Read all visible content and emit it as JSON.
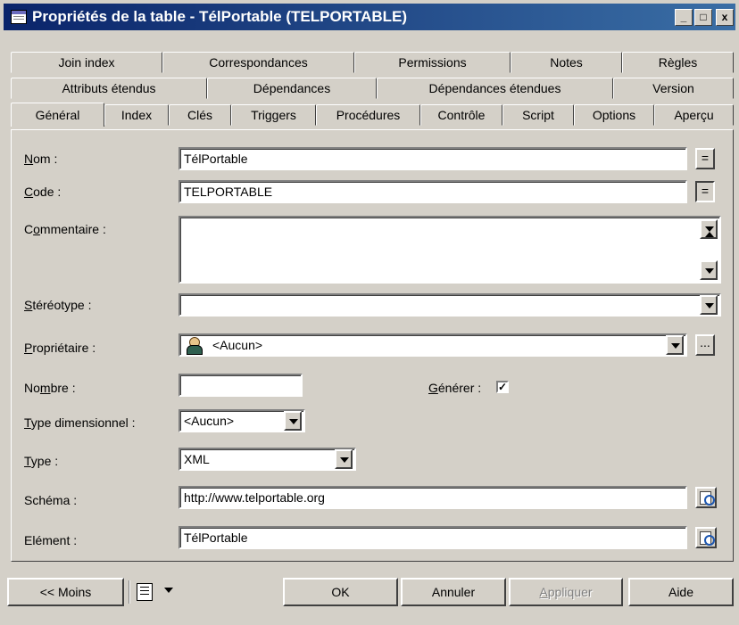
{
  "window": {
    "title": "Propriétés de la table - TélPortable (TELPORTABLE)",
    "controls": {
      "minimize": "_",
      "maximize": "□",
      "close": "x"
    }
  },
  "tabs": {
    "row1": [
      "Join index",
      "Correspondances",
      "Permissions",
      "Notes",
      "Règles"
    ],
    "row2": [
      "Attributs étendus",
      "Dépendances",
      "Dépendances étendues",
      "Version"
    ],
    "row3": [
      "Général",
      "Index",
      "Clés",
      "Triggers",
      "Procédures",
      "Contrôle",
      "Script",
      "Options",
      "Aperçu"
    ],
    "active": "Général"
  },
  "form": {
    "nom": {
      "label_ul": "N",
      "label_rest": "om :",
      "value": "TélPortable",
      "button": "="
    },
    "code": {
      "label_ul": "C",
      "label_rest": "ode :",
      "value": "TELPORTABLE",
      "button": "="
    },
    "commentaire": {
      "label_pre": "C",
      "label_ul": "o",
      "label_rest": "mmentaire :",
      "value": ""
    },
    "stereotype": {
      "label_ul": "S",
      "label_rest": "téréotype :",
      "value": ""
    },
    "proprietaire": {
      "label_ul": "P",
      "label_rest": "ropriétaire :",
      "value": "<Aucun>",
      "button": "..."
    },
    "nombre": {
      "label_pre": "No",
      "label_ul": "m",
      "label_rest": "bre :",
      "value": ""
    },
    "generer": {
      "label_ul": "G",
      "label_rest": "énérer :",
      "checked": "✓"
    },
    "type_dimensionnel": {
      "label_ul": "T",
      "label_rest": "ype dimensionnel :",
      "value": "<Aucun>"
    },
    "type": {
      "label_ul": "T",
      "label_rest": "ype :",
      "value": "XML"
    },
    "schema": {
      "label": "Schéma :",
      "value": "http://www.telportable.org"
    },
    "element": {
      "label": "Elément :",
      "value": "TélPortable"
    }
  },
  "footer": {
    "moins": "<< Moins",
    "ok": "OK",
    "annuler": "Annuler",
    "appliquer_ul": "A",
    "appliquer_rest": "ppliquer",
    "aide": "Aide"
  }
}
